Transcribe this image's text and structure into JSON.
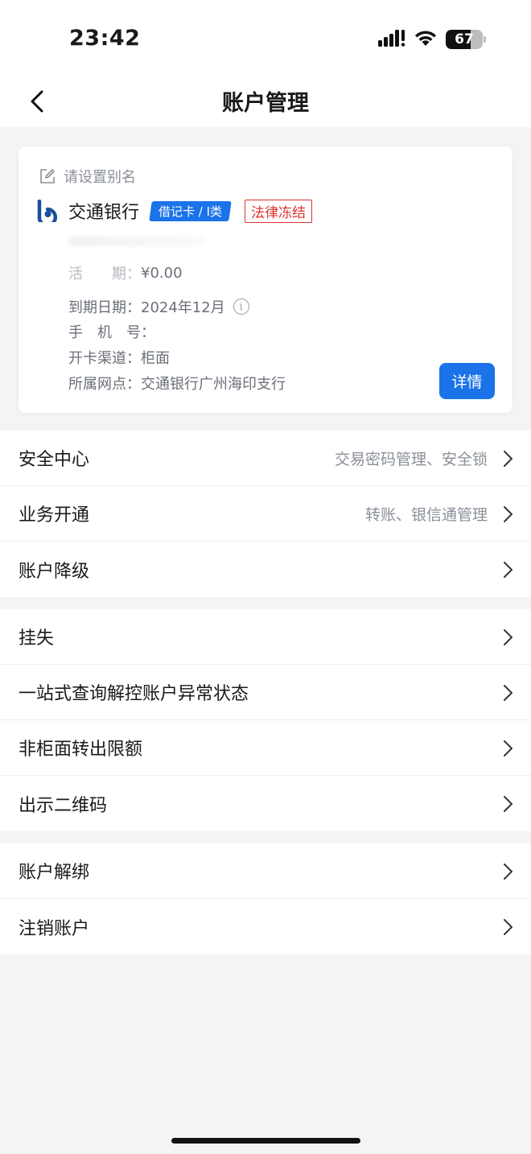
{
  "status_bar": {
    "time": "23:42",
    "battery": "67",
    "icons": [
      "signal-icon",
      "wifi-icon",
      "battery-icon"
    ]
  },
  "nav": {
    "title": "账户管理",
    "back_icon": "back-chevron-icon"
  },
  "account_card": {
    "alias_placeholder": "请设置别名",
    "bank_name": "交通银行",
    "card_type": "借记卡 / I类",
    "status": "法律冻结",
    "balance_label": "活　　期：",
    "balance_value": "¥0.00",
    "expiry_label": "到期日期：",
    "expiry_value": "2024年12月",
    "phone_label": "手　机　号：",
    "phone_value": "",
    "channel_label": "开卡渠道：",
    "channel_value": "柜面",
    "branch_label": "所属网点：",
    "branch_value": "交通银行广州海印支行",
    "detail_button": "详情"
  },
  "menu_groups": [
    {
      "items": [
        {
          "label": "安全中心",
          "sub": "交易密码管理、安全锁"
        },
        {
          "label": "业务开通",
          "sub": "转账、银信通管理"
        },
        {
          "label": "账户降级",
          "sub": ""
        }
      ]
    },
    {
      "items": [
        {
          "label": "挂失",
          "sub": ""
        },
        {
          "label": "一站式查询解控账户异常状态",
          "sub": ""
        },
        {
          "label": "非柜面转出限额",
          "sub": ""
        },
        {
          "label": "出示二维码",
          "sub": ""
        }
      ]
    },
    {
      "items": [
        {
          "label": "账户解绑",
          "sub": ""
        },
        {
          "label": "注销账户",
          "sub": ""
        }
      ]
    }
  ],
  "colors": {
    "primary": "#1a73e8",
    "danger": "#e0312e",
    "background": "#f4f4f6"
  }
}
